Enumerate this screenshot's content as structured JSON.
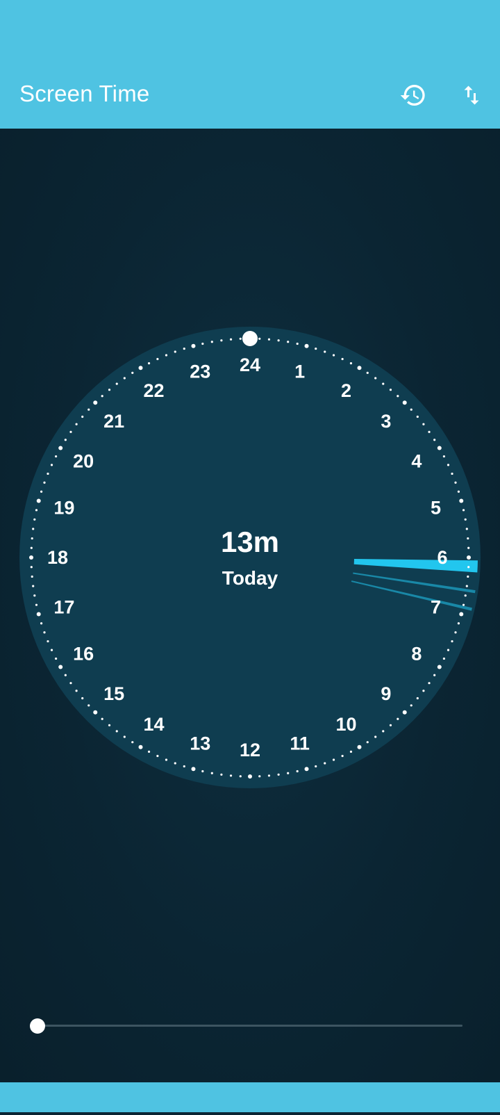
{
  "app_bar": {
    "title": "Screen Time",
    "background": "#4fc3e2",
    "icons": [
      "history-icon",
      "sort-arrows-icon"
    ]
  },
  "clock": {
    "hour_labels": [
      "24",
      "1",
      "2",
      "3",
      "4",
      "5",
      "6",
      "7",
      "8",
      "9",
      "10",
      "11",
      "12",
      "13",
      "14",
      "15",
      "16",
      "17",
      "18",
      "19",
      "20",
      "21",
      "22",
      "23"
    ],
    "face_color": "#0f3d50",
    "usage_color": "#22c6ee",
    "usage_segments": [
      {
        "start_hour": 6.05,
        "end_hour": 6.25,
        "intensity": "high"
      },
      {
        "start_hour": 6.55,
        "end_hour": 6.6,
        "intensity": "low"
      },
      {
        "start_hour": 6.85,
        "end_hour": 6.9,
        "intensity": "low"
      }
    ]
  },
  "summary": {
    "total": "13m",
    "period": "Today"
  },
  "slider": {
    "value": 0
  }
}
